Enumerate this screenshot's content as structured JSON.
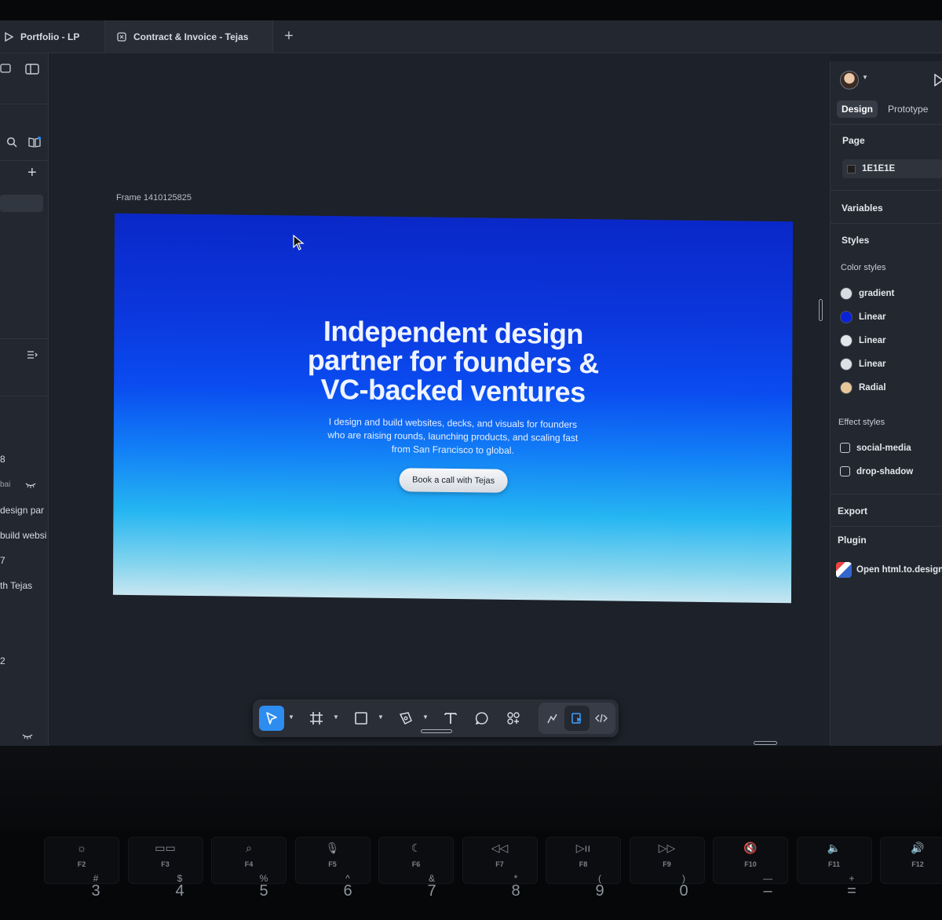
{
  "tabs": [
    {
      "label": "Portfolio - LP",
      "icon": "play-icon"
    },
    {
      "label": "Contract & Invoice - Tejas",
      "icon": "figma-file-icon"
    }
  ],
  "new_tab_label": "+",
  "left_panel": {
    "layer_fragments": [
      "8",
      "bai",
      "design par",
      "build websi",
      "7",
      "th Tejas",
      "2"
    ]
  },
  "canvas": {
    "frame_label": "Frame 1410125825",
    "hero": {
      "title": "Independent design partner for founders & VC-backed ventures",
      "subtitle": "I design and build websites, decks, and visuals for founders who are raising rounds, launching products, and scaling fast from San Francisco to global.",
      "cta": "Book a call with Tejas"
    },
    "gradient_colors": [
      "#0a28c8",
      "#0a4cf0",
      "#25b6f2",
      "#c7e6f1"
    ]
  },
  "toolbar": {
    "tools": [
      "move-tool",
      "frame-tool",
      "shape-tool",
      "pen-tool",
      "text-tool",
      "comment-tool",
      "actions-tool"
    ],
    "modes": [
      "draw-mode",
      "design-mode",
      "dev-mode"
    ]
  },
  "right_panel": {
    "tabs": [
      "Design",
      "Prototype"
    ],
    "page_label": "Page",
    "page_color": "1E1E1E",
    "variables_label": "Variables",
    "styles_label": "Styles",
    "color_styles_label": "Color styles",
    "color_styles": [
      {
        "name": "gradient",
        "color": "#d9dde3"
      },
      {
        "name": "Linear",
        "color": "#0a22d8"
      },
      {
        "name": "Linear",
        "color": "#e3e6ea"
      },
      {
        "name": "Linear",
        "color": "#dde1e6"
      },
      {
        "name": "Radial",
        "color": "#e8c89a"
      }
    ],
    "effect_styles_label": "Effect styles",
    "effect_styles": [
      "social-media",
      "drop-shadow"
    ],
    "export_label": "Export",
    "plugin_label": "Plugin",
    "plugin_item": "Open html.to.design"
  },
  "keyboard": {
    "fn_row": [
      {
        "label": "F2",
        "glyph": "☼"
      },
      {
        "label": "F3",
        "glyph": "▭▭"
      },
      {
        "label": "F4",
        "glyph": "⌕"
      },
      {
        "label": "F5",
        "glyph": "🎙"
      },
      {
        "label": "F6",
        "glyph": "☾"
      },
      {
        "label": "F7",
        "glyph": "◁◁"
      },
      {
        "label": "F8",
        "glyph": "▷ıı"
      },
      {
        "label": "F9",
        "glyph": "▷▷"
      },
      {
        "label": "F10",
        "glyph": "🔇"
      },
      {
        "label": "F11",
        "glyph": "🔈"
      },
      {
        "label": "F12",
        "glyph": "🔊"
      }
    ],
    "number_row": [
      {
        "sym": "#",
        "num": "3"
      },
      {
        "sym": "$",
        "num": "4"
      },
      {
        "sym": "%",
        "num": "5"
      },
      {
        "sym": "^",
        "num": "6"
      },
      {
        "sym": "&",
        "num": "7"
      },
      {
        "sym": "*",
        "num": "8"
      },
      {
        "sym": "(",
        "num": "9"
      },
      {
        "sym": ")",
        "num": "0"
      },
      {
        "sym": "—",
        "num": "–"
      },
      {
        "sym": "+",
        "num": "="
      }
    ]
  }
}
